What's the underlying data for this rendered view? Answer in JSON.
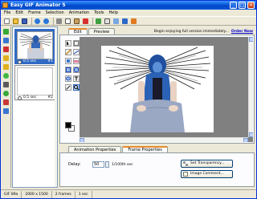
{
  "window": {
    "title": "Easy GIF Animator 5",
    "minimize_glyph": "_",
    "maximize_glyph": "□",
    "close_glyph": "×"
  },
  "menu": [
    "File",
    "Edit",
    "Frame",
    "Selection",
    "Animation",
    "Tools",
    "Help"
  ],
  "toolbar_icons": [
    "new-icon",
    "open-icon",
    "save-icon",
    "undo-icon",
    "redo-icon",
    "cut-icon",
    "copy-icon",
    "paste-icon",
    "delete-icon",
    "insert-frame-icon",
    "add-text-icon",
    "resize-icon",
    "preview-icon",
    "play-icon"
  ],
  "left_tools_icons": [
    "add-frame-icon",
    "duplicate-icon",
    "delete-frame-icon",
    "move-up-icon",
    "move-down-icon",
    "effects-icon",
    "crop-icon",
    "web-icon",
    "banner-icon",
    "export-icon"
  ],
  "frames": [
    {
      "delay": "0.5 sec",
      "number": "#1",
      "selected": true
    },
    {
      "delay": "0.5 sec",
      "number": "#2",
      "selected": false
    }
  ],
  "tabs_top": [
    {
      "label": "Edit",
      "active": true
    },
    {
      "label": "Preview",
      "active": false
    }
  ],
  "promo": {
    "text": "Begin enjoying full version immediately...",
    "link": "Order Now"
  },
  "edit_tools": [
    "select-rect-icon",
    "select-lasso-icon",
    "pencil-icon",
    "line-icon",
    "fill-icon",
    "eraser-icon",
    "rectangle-icon",
    "rounded-rect-icon",
    "ellipse-icon",
    "text-icon",
    "eyedropper-icon",
    "zoom-icon"
  ],
  "colors": {
    "foreground": "#000000",
    "background": "#ffffff"
  },
  "tabs_bottom": [
    {
      "label": "Animation Properties",
      "active": false
    },
    {
      "label": "Frame Properties",
      "active": true
    }
  ],
  "frame_properties": {
    "delay_label": "Delay:",
    "delay_value": "50",
    "delay_unit": "1/100th sec",
    "set_transparency_label": "Set Transparency...",
    "image_comment_label": "Image Comment..."
  },
  "status": [
    "GIF 89a",
    "2000 x 1500",
    "2 frames",
    "1 sec"
  ]
}
